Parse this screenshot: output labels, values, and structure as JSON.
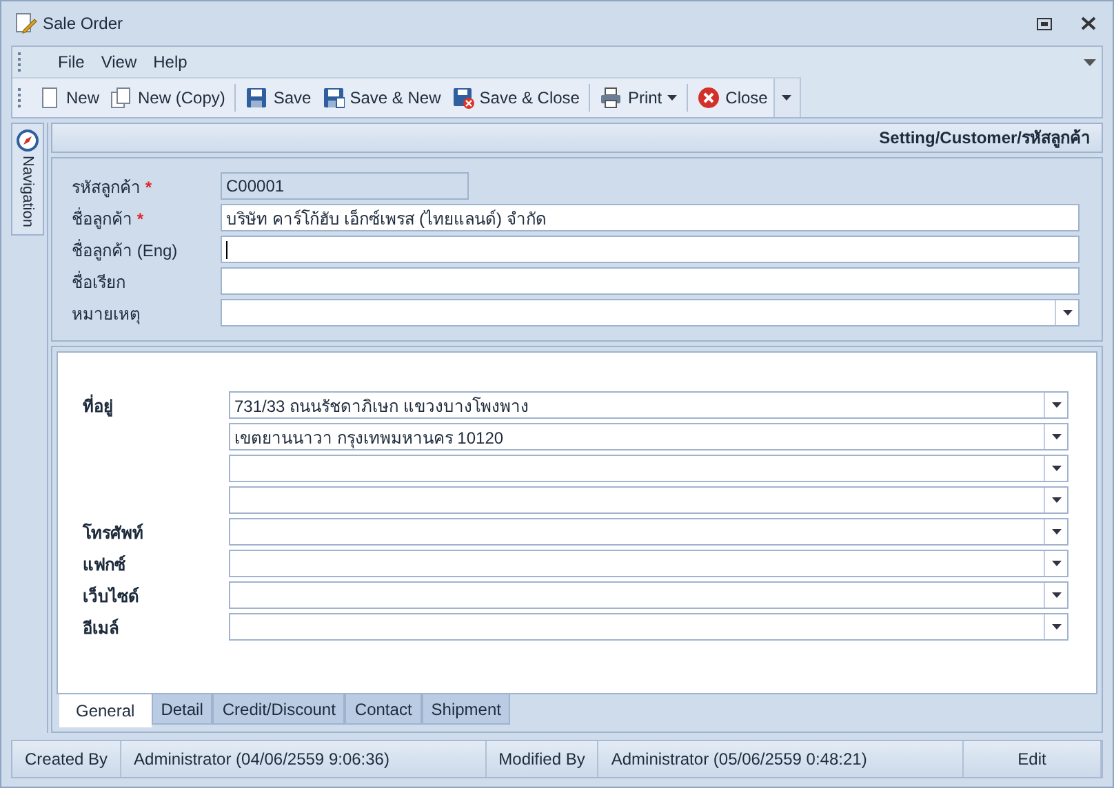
{
  "window": {
    "title": "Sale Order"
  },
  "menu": [
    "File",
    "View",
    "Help"
  ],
  "toolbar": {
    "groups": [
      [
        {
          "label": "New"
        },
        {
          "label": "New (Copy)"
        }
      ],
      [
        {
          "label": "Save"
        },
        {
          "label": "Save & New"
        },
        {
          "label": "Save & Close"
        }
      ],
      [
        {
          "label": "Print",
          "has_menu": true
        }
      ],
      [
        {
          "label": "Close"
        }
      ]
    ]
  },
  "navigation": {
    "label": "Navigation"
  },
  "breadcrumb": "Setting/Customer/รหัสลูกค้า",
  "header_fields": [
    {
      "label": "รหัสลูกค้า",
      "marker": "*",
      "kind": "readonly",
      "value": "C00001"
    },
    {
      "label": "ชื่อลูกค้า",
      "marker": "*",
      "kind": "text",
      "value": "บริษัท คาร์โก้ฮับ เอ็กซ์เพรส (ไทยแลนด์) จำกัด"
    },
    {
      "label": "ชื่อลูกค้า (Eng)",
      "kind": "text",
      "focused": true
    },
    {
      "label": "ชื่อเรียก",
      "kind": "text"
    },
    {
      "label": "หมายเหตุ",
      "kind": "combo"
    }
  ],
  "general_fields": [
    {
      "label": "ที่อยู่",
      "kind": "combo",
      "value": "731/33 ถนนรัชดาภิเษก แขวงบางโพงพาง"
    },
    {
      "kind": "combo",
      "value": "เขตยานนาวา กรุงเทพมหานคร 10120"
    },
    {
      "kind": "combo"
    },
    {
      "kind": "combo"
    },
    {
      "label": "โทรศัพท์",
      "kind": "combo"
    },
    {
      "label": "แฟกซ์",
      "kind": "combo"
    },
    {
      "label": "เว็บไซด์",
      "kind": "combo"
    },
    {
      "label": "อีเมล์",
      "kind": "combo"
    }
  ],
  "tabs": [
    {
      "label": "General",
      "selected": true
    },
    {
      "label": "Detail",
      "selected": false
    },
    {
      "label": "Credit/Discount",
      "selected": false
    },
    {
      "label": "Contact",
      "selected": false
    },
    {
      "label": "Shipment",
      "selected": false
    }
  ],
  "status_bar": [
    {
      "kind": "label",
      "text": "Created By"
    },
    {
      "kind": "value",
      "text": "Administrator (04/06/2559 9:06:36)"
    },
    {
      "kind": "label",
      "text": "Modified By"
    },
    {
      "kind": "value",
      "text": "Administrator (05/06/2559 0:48:21)"
    },
    {
      "kind": "mode",
      "text": "Edit"
    }
  ]
}
